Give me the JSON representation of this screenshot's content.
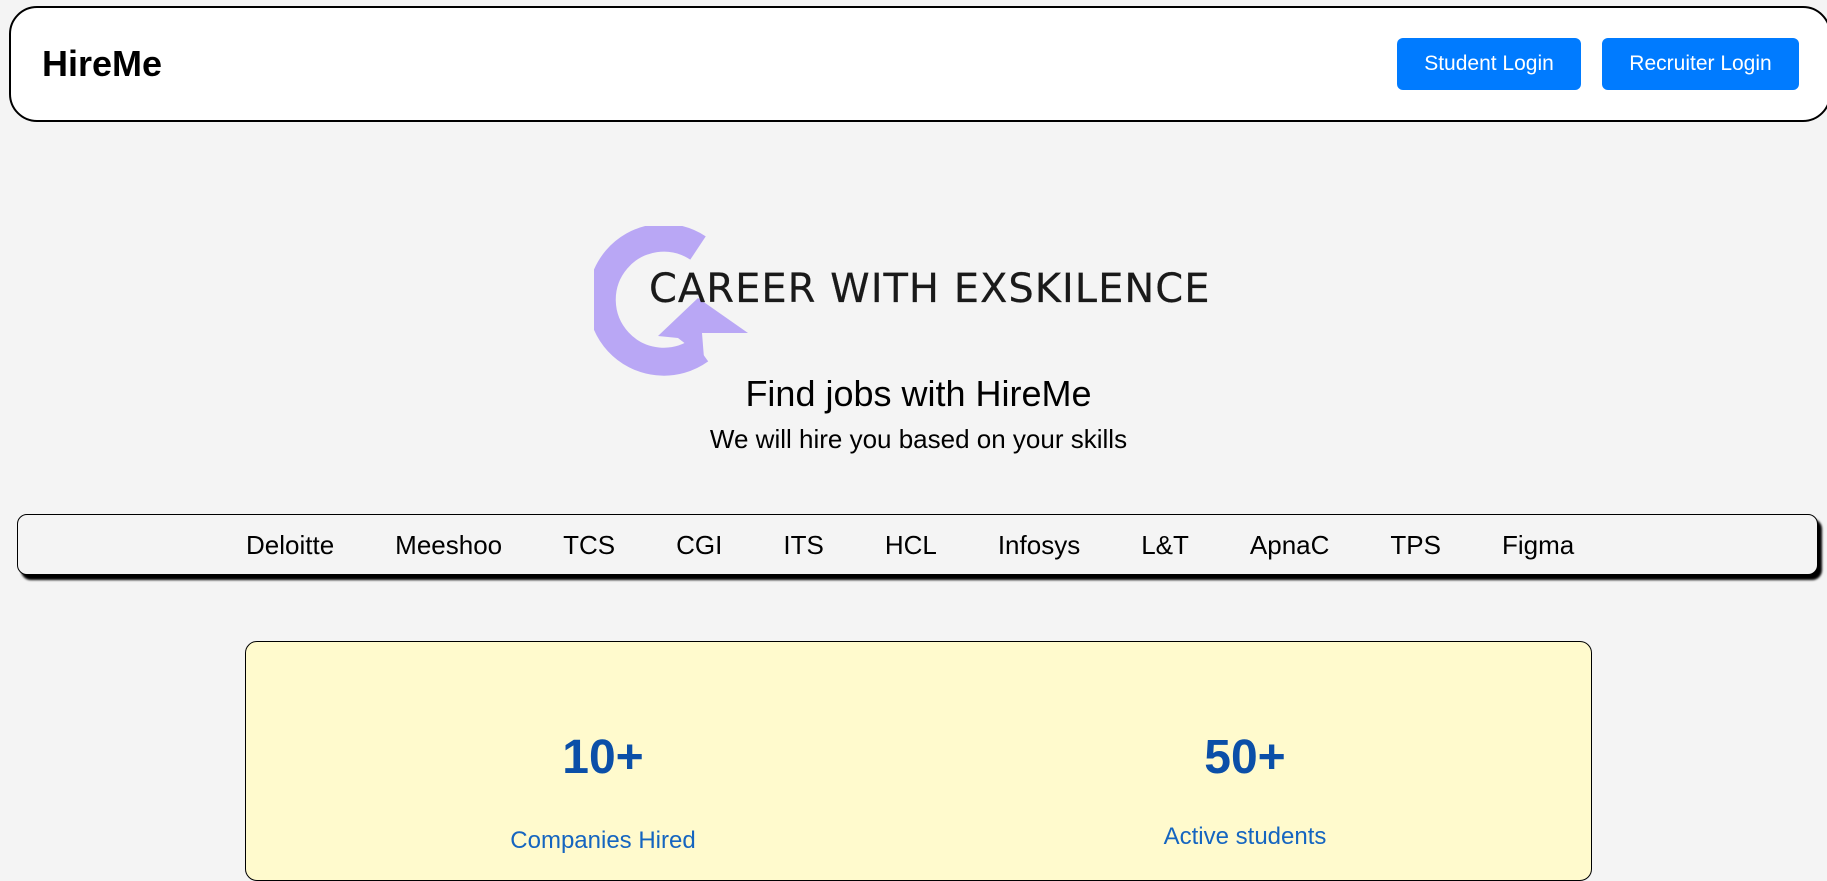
{
  "navbar": {
    "brand": "HireMe",
    "student_login": "Student Login",
    "recruiter_login": "Recruiter Login",
    "accent_color": "#007bff"
  },
  "logo": {
    "text": "CAREER WITH EXSKILENCE",
    "icon": "circular-arrow-icon",
    "color": "#b9a7f5"
  },
  "hero": {
    "title": "Find jobs with HireMe",
    "subtitle": "We will hire you based on your skills"
  },
  "companies": [
    "Deloitte",
    "Meeshoo",
    "TCS",
    "CGI",
    "ITS",
    "HCL",
    "Infosys",
    "L&T",
    "ApnaC",
    "TPS",
    "Figma"
  ],
  "stats": [
    {
      "value": "10+",
      "label": "Companies Hired"
    },
    {
      "value": "50+",
      "label": "Active students"
    }
  ],
  "colors": {
    "background": "#f4f4f4",
    "stats_card": "#fffacd",
    "stats_text": "#0b4fa8"
  }
}
